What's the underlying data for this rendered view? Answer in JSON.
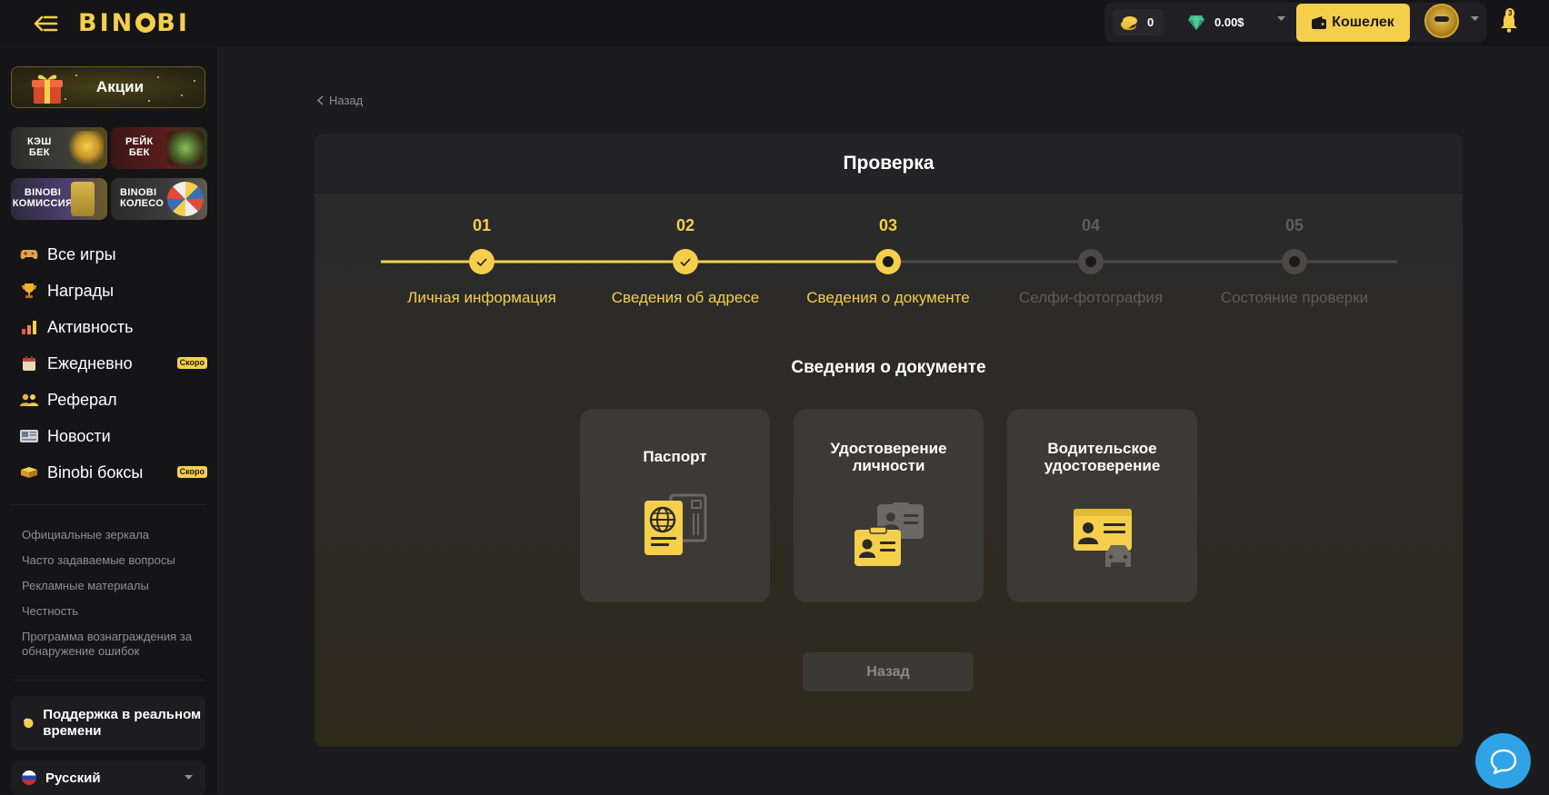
{
  "header": {
    "logo": "BIN",
    "logo_tail": "BI",
    "coins": "0",
    "gems_balance": "0.00$",
    "wallet_label": "Кошелек",
    "notification_count": "3"
  },
  "sidebar": {
    "promo_label": "Акции",
    "tiles": [
      {
        "line1": "КЭШ",
        "line2": "БЕК"
      },
      {
        "line1": "РЕЙК",
        "line2": "БЕК"
      },
      {
        "line1": "BINOBI",
        "line2": "КОМИССИЯ"
      },
      {
        "line1": "BINOBI",
        "line2": "КОЛЕСО"
      }
    ],
    "nav": [
      {
        "label": "Все игры",
        "icon": "controller-icon"
      },
      {
        "label": "Награды",
        "icon": "trophy-icon"
      },
      {
        "label": "Активность",
        "icon": "chart-icon"
      },
      {
        "label": "Ежедневно",
        "icon": "calendar-icon",
        "badge": "Скоро"
      },
      {
        "label": "Реферал",
        "icon": "users-icon"
      },
      {
        "label": "Новости",
        "icon": "news-icon"
      },
      {
        "label": "Binobi боксы",
        "icon": "box-icon",
        "badge": "Скоро"
      }
    ],
    "footer_links": [
      "Официальные зеркала",
      "Часто задаваемые вопросы",
      "Рекламные материалы",
      "Честность",
      "Программа вознаграждения за обнаружение ошибок"
    ],
    "support_label": "Поддержка в реальном времени",
    "language": "Русский"
  },
  "main": {
    "back_link": "Назад",
    "card_title": "Проверка",
    "steps": [
      {
        "num": "01",
        "label": "Личная информация",
        "state": "done"
      },
      {
        "num": "02",
        "label": "Сведения об адресе",
        "state": "done"
      },
      {
        "num": "03",
        "label": "Сведения о документе",
        "state": "current"
      },
      {
        "num": "04",
        "label": "Селфи-фотография",
        "state": "pending"
      },
      {
        "num": "05",
        "label": "Состояние проверки",
        "state": "pending"
      }
    ],
    "section_title": "Сведения о документе",
    "documents": [
      {
        "label": "Паспорт",
        "icon": "passport-icon"
      },
      {
        "label": "Удостоверение личности",
        "icon": "id-card-icon"
      },
      {
        "label": "Водительское удостоверение",
        "icon": "driver-license-icon"
      }
    ],
    "back_button": "Назад"
  },
  "colors": {
    "accent": "#f5cf4b",
    "inactive": "#5e5d5a",
    "chat": "#2fa3e6"
  }
}
